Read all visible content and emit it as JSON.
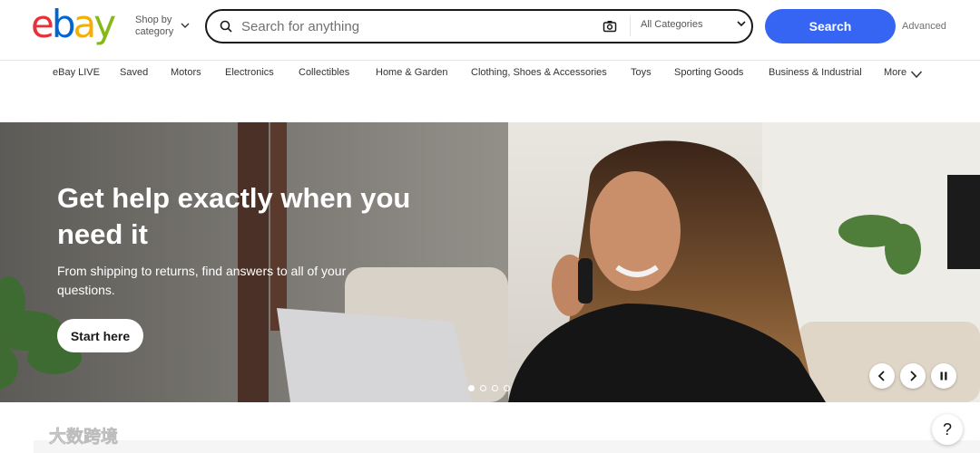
{
  "header": {
    "logo_letters": [
      "e",
      "b",
      "a",
      "y"
    ],
    "logo_colors": [
      "#e53238",
      "#0064d2",
      "#f5af02",
      "#86b817"
    ],
    "shop_by_line1": "Shop by",
    "shop_by_line2": "category",
    "search_placeholder": "Search for anything",
    "category_selected": "All Categories",
    "search_label": "Search",
    "advanced_label": "Advanced",
    "accent_color": "#3665f3"
  },
  "nav": {
    "items": [
      "eBay LIVE",
      "Saved",
      "Motors",
      "Electronics",
      "Collectibles",
      "Home & Garden",
      "Clothing, Shoes & Accessories",
      "Toys",
      "Sporting Goods",
      "Business & Industrial",
      "More"
    ]
  },
  "hero": {
    "title": "Get help exactly when you need it",
    "subtitle": "From shipping to returns, find answers to all of your questions.",
    "cta_label": "Start here",
    "slide_count": 4,
    "active_slide": 1,
    "icons": {
      "prev": "chevron-left-icon",
      "next": "chevron-right-icon",
      "pause": "pause-icon"
    }
  },
  "help": {
    "label": "?"
  },
  "watermark": {
    "text": "大数跨境"
  }
}
